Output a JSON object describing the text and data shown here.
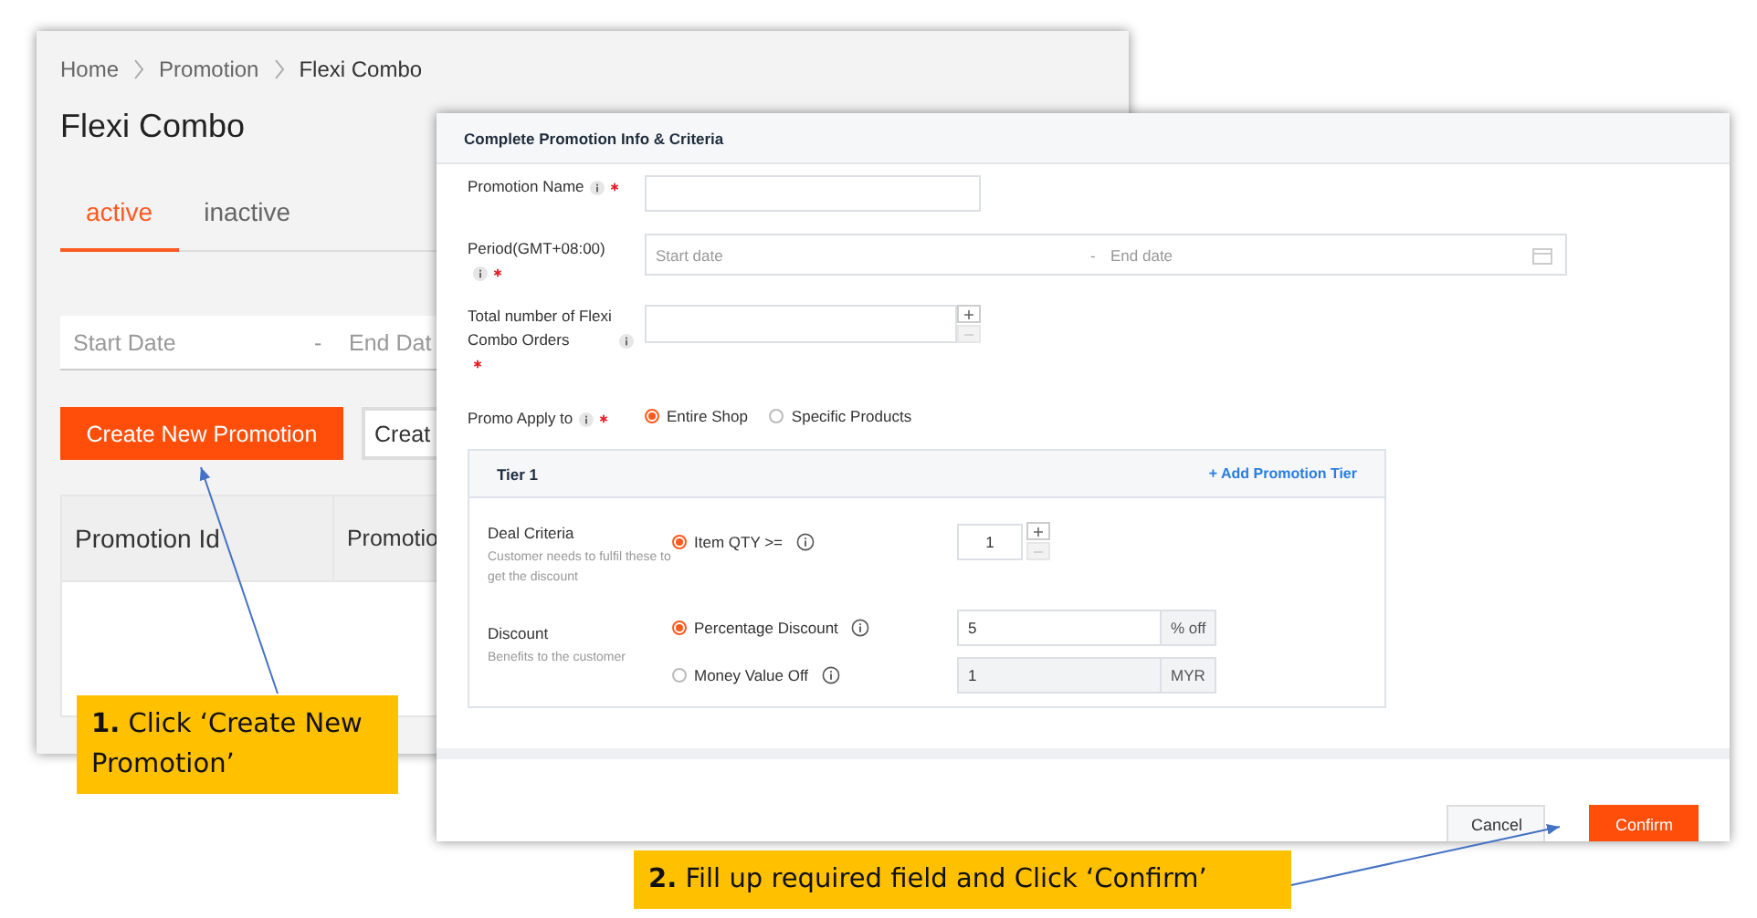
{
  "back_window": {
    "breadcrumb": [
      "Home",
      "Promotion",
      "Flexi Combo"
    ],
    "title": "Flexi Combo",
    "tabs": [
      {
        "label": "active",
        "selected": true
      },
      {
        "label": "inactive",
        "selected": false
      }
    ],
    "date_range": {
      "start_placeholder": "Start Date",
      "separator": "-",
      "end_placeholder": "End Dat"
    },
    "buttons": [
      {
        "label": "Create New Promotion",
        "kind": "primary"
      },
      {
        "label": "Creat",
        "kind": "secondary"
      }
    ],
    "table": {
      "columns": [
        "Promotion Id",
        "Promotio"
      ]
    }
  },
  "dialog": {
    "title": "Complete Promotion Info & Criteria",
    "fields": [
      {
        "kind": "text",
        "label": "Promotion Name",
        "required": true
      },
      {
        "kind": "daterange",
        "label": "Period(GMT+08:00)",
        "required": true,
        "start_placeholder": "Start date",
        "separator": "-",
        "end_placeholder": "End date"
      },
      {
        "kind": "number",
        "label": "Total number of Flexi Combo Orders",
        "required": true
      },
      {
        "kind": "radio",
        "label": "Promo Apply to",
        "required": true,
        "options": [
          {
            "label": "Entire Shop",
            "selected": true
          },
          {
            "label": "Specific Products",
            "selected": false
          }
        ]
      }
    ],
    "tier": {
      "title": "Tier 1",
      "add_link": "+ Add Promotion Tier",
      "sections": [
        {
          "label": "Deal Criteria",
          "hint": "Customer needs to fulfil these to get the discount",
          "options": [
            {
              "label": "Item QTY >=",
              "selected": true,
              "value": "1",
              "kind": "stepper"
            }
          ]
        },
        {
          "label": "Discount",
          "hint": "Benefits to the customer",
          "options": [
            {
              "label": "Percentage Discount",
              "selected": true,
              "value": "5",
              "unit": "% off",
              "kind": "addon"
            },
            {
              "label": "Money Value Off",
              "selected": false,
              "value": "1",
              "unit": "MYR",
              "kind": "addon"
            }
          ]
        }
      ]
    },
    "buttons": [
      {
        "label": "Cancel",
        "kind": "secondary"
      },
      {
        "label": "Confirm",
        "kind": "primary"
      }
    ]
  },
  "callouts": [
    {
      "text": "**1.** Click ‘Create New Promotion’"
    },
    {
      "text": "**2.** Fill up required field and Click ‘Confirm’"
    }
  ]
}
